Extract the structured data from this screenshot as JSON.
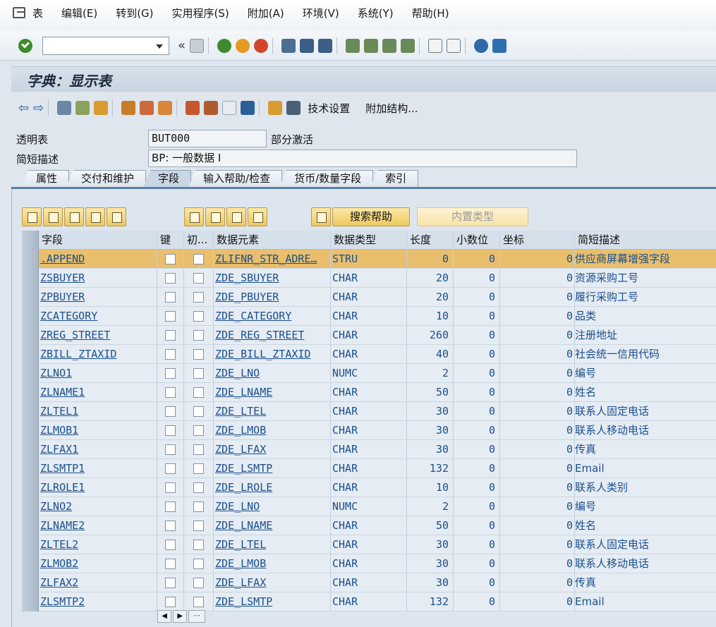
{
  "menu": [
    "表",
    "编辑(E)",
    "转到(G)",
    "实用程序(S)",
    "附加(A)",
    "环境(V)",
    "系统(Y)",
    "帮助(H)"
  ],
  "toolbar": {
    "command_value": ""
  },
  "title": "字典：显示表",
  "app_toolbar": {
    "tech_settings": "技术设置",
    "append_struct": "附加结构..."
  },
  "header": {
    "table_label": "透明表",
    "table_value": "BUT000",
    "status": "部分激活",
    "desc_label": "简短描述",
    "desc_value": "BP: 一般数据 I"
  },
  "tabs": [
    "属性",
    "交付和维护",
    "字段",
    "输入帮助/检查",
    "货币/数量字段",
    "索引"
  ],
  "active_tab": "字段",
  "table_buttons": {
    "search_help": "搜索帮助",
    "builtin_type": "内置类型"
  },
  "columns": [
    "字段",
    "键",
    "初...",
    "数据元素",
    "数据类型",
    "长度",
    "小数位",
    "坐标",
    "简短描述"
  ],
  "rows": [
    {
      "field": ".APPEND",
      "element": "ZLIFNR_STR_ADRE…",
      "type": "STRU",
      "length": "0",
      "decimals": "0",
      "coord": "0",
      "desc": "供应商屏幕增强字段"
    },
    {
      "field": "ZSBUYER",
      "element": "ZDE_SBUYER",
      "type": "CHAR",
      "length": "20",
      "decimals": "0",
      "coord": "0",
      "desc": "资源采购工号"
    },
    {
      "field": "ZPBUYER",
      "element": "ZDE_PBUYER",
      "type": "CHAR",
      "length": "20",
      "decimals": "0",
      "coord": "0",
      "desc": "履行采购工号"
    },
    {
      "field": "ZCATEGORY",
      "element": "ZDE_CATEGORY",
      "type": "CHAR",
      "length": "10",
      "decimals": "0",
      "coord": "0",
      "desc": "品类"
    },
    {
      "field": "ZREG_STREET",
      "element": "ZDE_REG_STREET",
      "type": "CHAR",
      "length": "260",
      "decimals": "0",
      "coord": "0",
      "desc": "注册地址"
    },
    {
      "field": "ZBILL_ZTAXID",
      "element": "ZDE_BILL_ZTAXID",
      "type": "CHAR",
      "length": "40",
      "decimals": "0",
      "coord": "0",
      "desc": "社会统一信用代码"
    },
    {
      "field": "ZLNO1",
      "element": "ZDE_LNO",
      "type": "NUMC",
      "length": "2",
      "decimals": "0",
      "coord": "0",
      "desc": "编号"
    },
    {
      "field": "ZLNAME1",
      "element": "ZDE_LNAME",
      "type": "CHAR",
      "length": "50",
      "decimals": "0",
      "coord": "0",
      "desc": "姓名"
    },
    {
      "field": "ZLTEL1",
      "element": "ZDE_LTEL",
      "type": "CHAR",
      "length": "30",
      "decimals": "0",
      "coord": "0",
      "desc": "联系人固定电话"
    },
    {
      "field": "ZLMOB1",
      "element": "ZDE_LMOB",
      "type": "CHAR",
      "length": "30",
      "decimals": "0",
      "coord": "0",
      "desc": "联系人移动电话"
    },
    {
      "field": "ZLFAX1",
      "element": "ZDE_LFAX",
      "type": "CHAR",
      "length": "30",
      "decimals": "0",
      "coord": "0",
      "desc": "传真"
    },
    {
      "field": "ZLSMTP1",
      "element": "ZDE_LSMTP",
      "type": "CHAR",
      "length": "132",
      "decimals": "0",
      "coord": "0",
      "desc": "Email"
    },
    {
      "field": "ZLROLE1",
      "element": "ZDE_LROLE",
      "type": "CHAR",
      "length": "10",
      "decimals": "0",
      "coord": "0",
      "desc": "联系人类别"
    },
    {
      "field": "ZLNO2",
      "element": "ZDE_LNO",
      "type": "NUMC",
      "length": "2",
      "decimals": "0",
      "coord": "0",
      "desc": "编号"
    },
    {
      "field": "ZLNAME2",
      "element": "ZDE_LNAME",
      "type": "CHAR",
      "length": "50",
      "decimals": "0",
      "coord": "0",
      "desc": "姓名"
    },
    {
      "field": "ZLTEL2",
      "element": "ZDE_LTEL",
      "type": "CHAR",
      "length": "30",
      "decimals": "0",
      "coord": "0",
      "desc": "联系人固定电话"
    },
    {
      "field": "ZLMOB2",
      "element": "ZDE_LMOB",
      "type": "CHAR",
      "length": "30",
      "decimals": "0",
      "coord": "0",
      "desc": "联系人移动电话"
    },
    {
      "field": "ZLFAX2",
      "element": "ZDE_LFAX",
      "type": "CHAR",
      "length": "30",
      "decimals": "0",
      "coord": "0",
      "desc": "传真"
    },
    {
      "field": "ZLSMTP2",
      "element": "ZDE_LSMTP",
      "type": "CHAR",
      "length": "132",
      "decimals": "0",
      "coord": "0",
      "desc": "Email"
    }
  ],
  "colors": {
    "selected_row": "#e9bf6d",
    "link": "#1b4f8c",
    "ok": "#3d8b2d"
  }
}
